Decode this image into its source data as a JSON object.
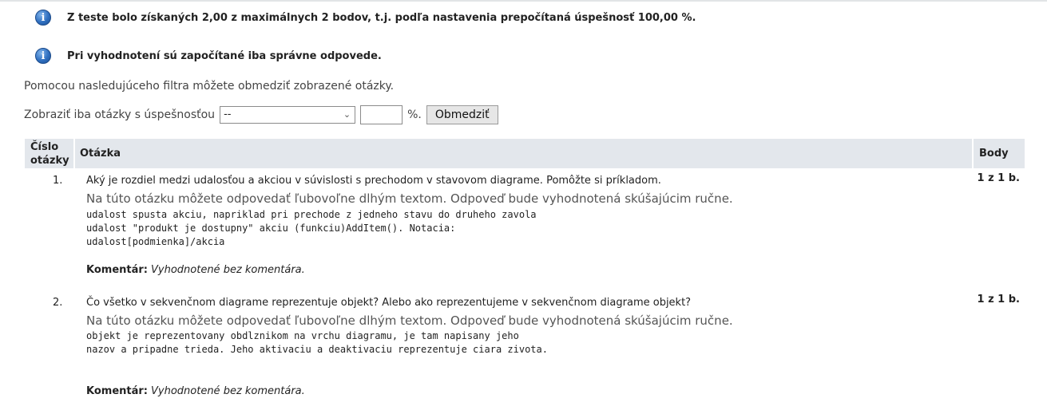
{
  "messages": [
    {
      "icon": "info-icon",
      "text": "Z teste bolo získaných 2,00 z maximálnych 2 bodov, t.j. podľa nastavenia prepočítaná úspešnosť 100,00 %."
    },
    {
      "icon": "info-icon",
      "text": "Pri vyhodnotení sú započítané iba správne odpovede."
    }
  ],
  "filter": {
    "note": "Pomocou nasledujúceho filtra môžete obmedziť zobrazené otázky.",
    "label": "Zobraziť iba otázky s úspešnosťou",
    "select_value": "--",
    "percent_value": "",
    "percent_sign": "%.",
    "button_label": "Obmedziť"
  },
  "table": {
    "headers": {
      "number_line1": "Číslo",
      "number_line2": "otázky",
      "question": "Otázka",
      "points": "Body"
    },
    "rows": [
      {
        "number": "1.",
        "question": "Aký je rozdiel medzi udalosťou a akciou v súvislosti s prechodom v stavovom diagrame. Pomôžte si príkladom.",
        "note": "Na túto otázku môžete odpovedať ľubovoľne dlhým textom. Odpoveď bude vyhodnotená skúšajúcim ručne.",
        "answer_lines": [
          "udalost spusta akciu, napriklad pri prechode z jedneho stavu do druheho zavola",
          "udalost \"produkt je dostupny\" akciu (funkciu)AddItem(). Notacia:",
          "udalost[podmienka]/akcia"
        ],
        "comment_label": "Komentár:",
        "comment_value": "Vyhodnotené bez komentára.",
        "points": "1 z 1 b."
      },
      {
        "number": "2.",
        "question": "Čo všetko v sekvenčnom diagrame reprezentuje objekt? Alebo ako reprezentujeme v sekvenčnom diagrame objekt?",
        "note": "Na túto otázku môžete odpovedať ľubovoľne dlhým textom. Odpoveď bude vyhodnotená skúšajúcim ručne.",
        "answer_lines": [
          "objekt je reprezentovany obdlznikom na vrchu diagramu, je tam napisany jeho",
          "nazov a pripadne trieda. Jeho aktivaciu a deaktivaciu reprezentuje ciara zivota."
        ],
        "comment_label": "Komentár:",
        "comment_value": "Vyhodnotené bez komentára.",
        "points": "1 z 1 b."
      }
    ]
  }
}
